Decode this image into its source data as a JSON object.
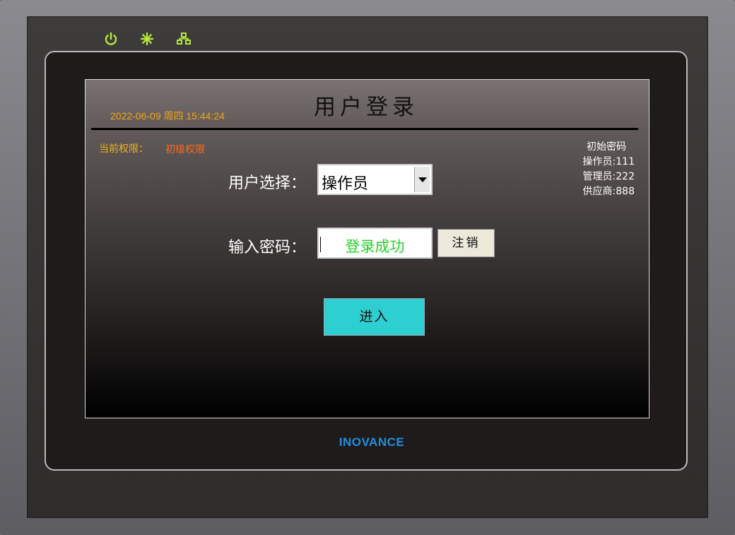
{
  "device": {
    "brand": "INOVANCE",
    "indicators": [
      {
        "icon": "power-icon",
        "glyph": "⏻"
      },
      {
        "icon": "sun-icon",
        "glyph": "✱"
      },
      {
        "icon": "network-icon",
        "glyph": "品"
      }
    ],
    "indicator_color": "#b3e63a"
  },
  "screen": {
    "title": "用户登录",
    "datetime": "2022-06-09 周四 15:44:24",
    "permission_label": "当前权限：",
    "permission_value": "初级权限",
    "password_hint": {
      "heading": "初始密码",
      "lines": [
        "操作员:111",
        "管理员:222",
        "供应商:888"
      ]
    },
    "user_select": {
      "label": "用户选择：",
      "value": "操作员"
    },
    "password": {
      "label": "输入密码：",
      "status": "登录成功"
    },
    "logout_button": "注销",
    "enter_button": "进入"
  },
  "colors": {
    "datetime": "#f2a516",
    "permission_value": "#ff6a1a",
    "success": "#27d12a",
    "enter_button": "#2ecfd0",
    "brand": "#1f8fe0"
  }
}
